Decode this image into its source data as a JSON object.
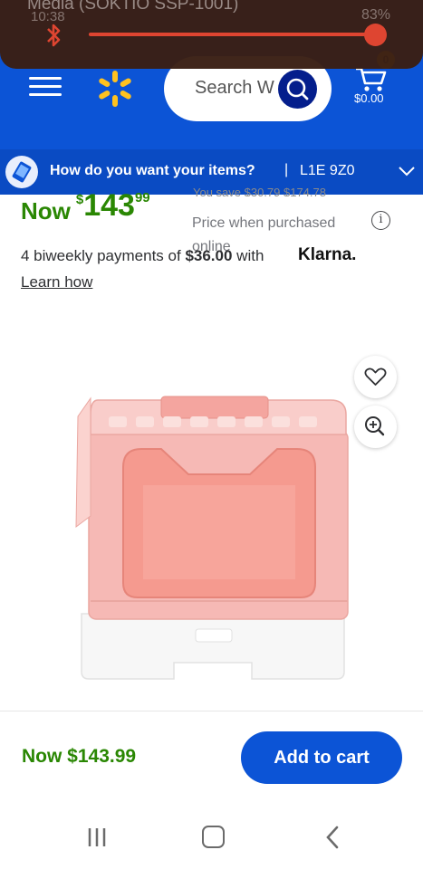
{
  "status_bar": {
    "media_title": "Media (SOKTIO SSP-1001)",
    "time": "10:38",
    "battery": "83%"
  },
  "header": {
    "search_placeholder": "Search W",
    "cart_count": "0",
    "cart_total": "$0.00"
  },
  "delivery": {
    "question": "How do you want your items?",
    "separator": "|",
    "postal_code": "L1E 9Z0"
  },
  "price": {
    "now_label": "Now",
    "currency": "$",
    "dollars": "143",
    "cents": "99",
    "was_text": "You save $30.79 $174.78",
    "price_when_purchased": "Price when purchased online",
    "info_glyph": "i"
  },
  "klarna": {
    "prefix": "4 biweekly payments of",
    "amount": "$36.00",
    "suffix": "with",
    "logo_text": "Klarna.",
    "learn_how": "Learn how"
  },
  "bottom_bar": {
    "price_text": "Now $143.99",
    "add_to_cart": "Add to cart"
  },
  "colors": {
    "walmart_blue": "#0c54d6",
    "price_green": "#2a8703",
    "spark_yellow": "#ffc220",
    "product_pink": "#f6b7b2"
  },
  "icons": [
    "bluetooth-icon",
    "menu-icon",
    "walmart-spark-logo",
    "search-icon",
    "cart-icon",
    "delivery-icon",
    "chevron-down-icon",
    "info-icon",
    "heart-icon",
    "zoom-in-icon",
    "recent-apps-icon",
    "home-icon",
    "back-icon"
  ]
}
